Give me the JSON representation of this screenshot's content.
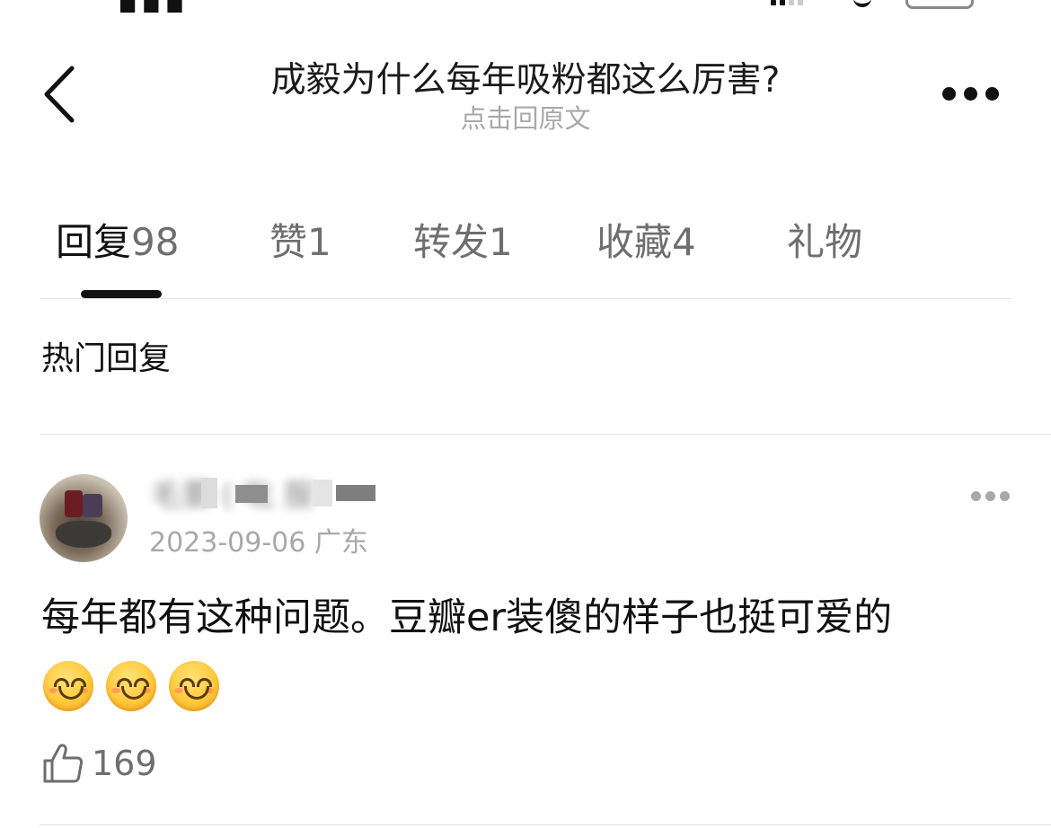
{
  "post": {
    "title": "成毅为什么每年吸粉都这么厉害?",
    "subtitle": "点击回原文"
  },
  "tabs": [
    {
      "label": "回复",
      "count": "98",
      "active": true
    },
    {
      "label": "赞",
      "count": "1",
      "active": false
    },
    {
      "label": "转发",
      "count": "1",
      "active": false
    },
    {
      "label": "收藏",
      "count": "4",
      "active": false
    },
    {
      "label": "礼物",
      "count": "",
      "active": false
    }
  ],
  "section": {
    "title": "热门回复"
  },
  "comment": {
    "username": "毛要 ( 吡   服",
    "date": "2023-09-06",
    "location": "广东",
    "text": "每年都有这种问题。豆瓣er装傻的样子也挺可爱的",
    "emojis": [
      "smiling-face-icon",
      "smiling-face-icon",
      "smiling-face-icon"
    ],
    "like_count": "169"
  },
  "icons": {
    "back": "chevron-left-icon",
    "more": "more-horizontal-icon",
    "like": "thumbs-up-icon"
  },
  "colors": {
    "primary_text": "#111111",
    "secondary_text": "#a8a8a8",
    "tab_inactive": "#6e6e6e",
    "emoji_yellow": "#ffc93a"
  }
}
